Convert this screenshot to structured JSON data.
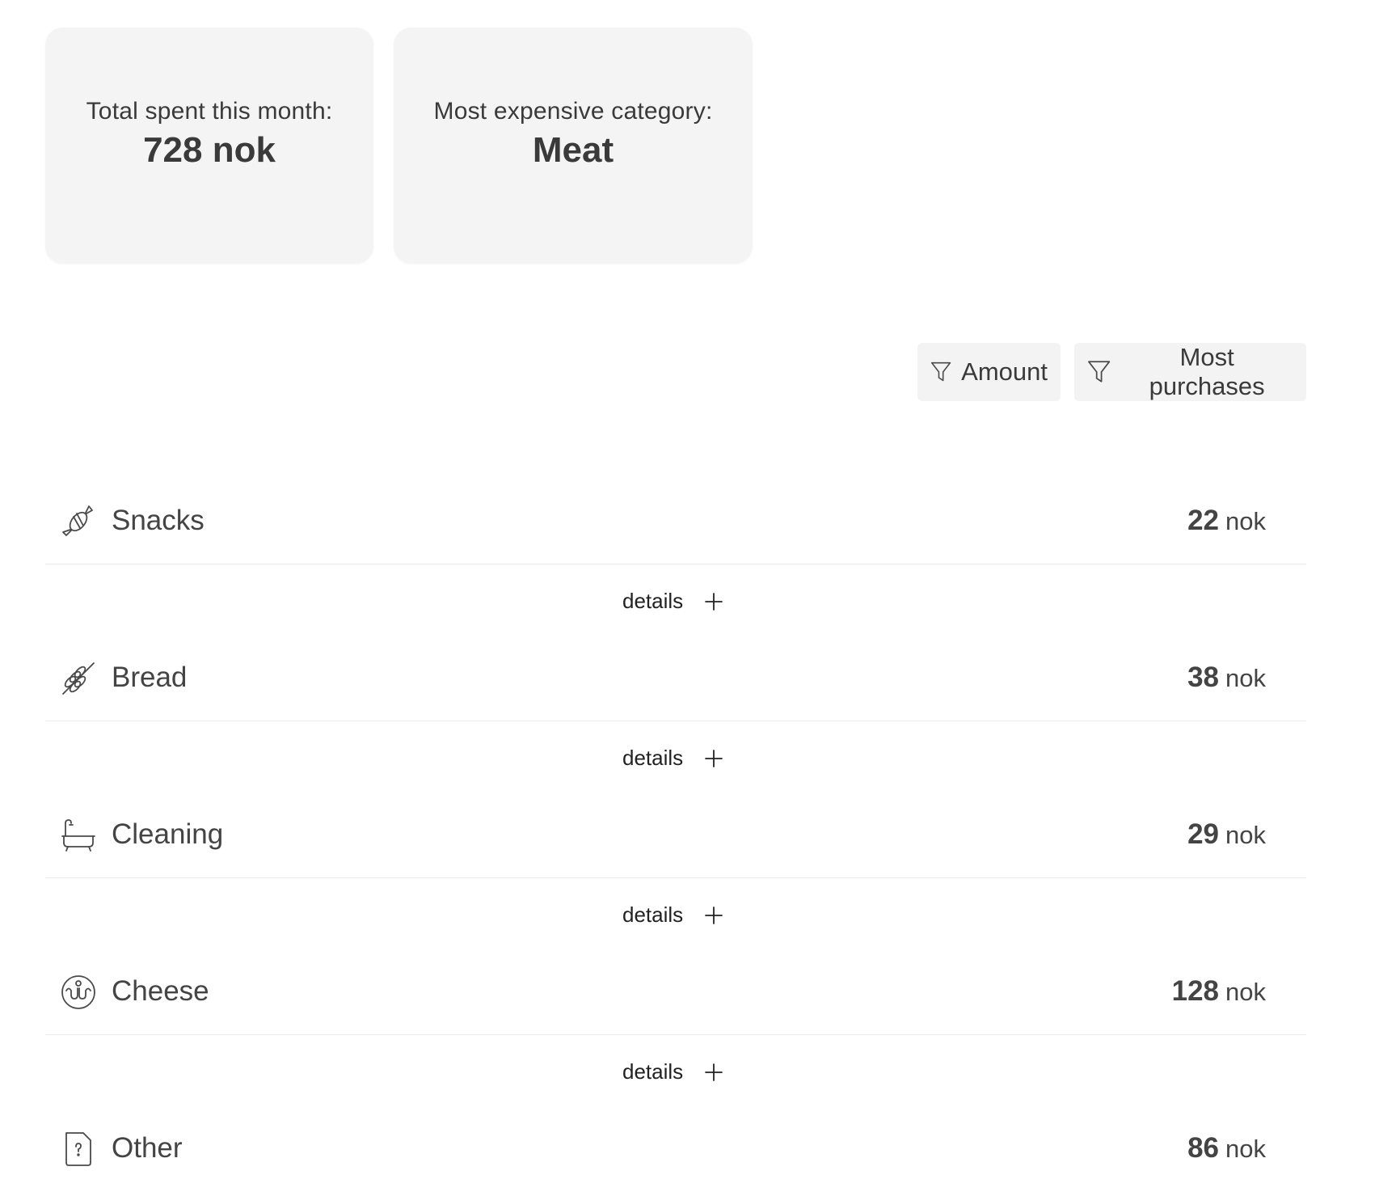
{
  "summary": {
    "total_label": "Total spent this month:",
    "total_value": "728 nok",
    "category_label": "Most expensive category:",
    "category_value": "Meat"
  },
  "filters": {
    "amount_label": "Amount",
    "most_purchases_label": "Most purchases",
    "icon": "filter-icon"
  },
  "categories": [
    {
      "name": "Snacks",
      "amount": "22",
      "unit": "nok",
      "icon": "candy-icon"
    },
    {
      "name": "Bread",
      "amount": "38",
      "unit": "nok",
      "icon": "wheat-icon"
    },
    {
      "name": "Cleaning",
      "amount": "29",
      "unit": "nok",
      "icon": "bathtub-icon"
    },
    {
      "name": "Cheese",
      "amount": "128",
      "unit": "nok",
      "icon": "cheese-icon"
    },
    {
      "name": "Other",
      "amount": "86",
      "unit": "nok",
      "icon": "unknown-file-icon"
    }
  ],
  "details_label": "details",
  "colors": {
    "card_bg": "#f4f4f4",
    "text": "#3a3a3a",
    "divider": "#ececec"
  }
}
